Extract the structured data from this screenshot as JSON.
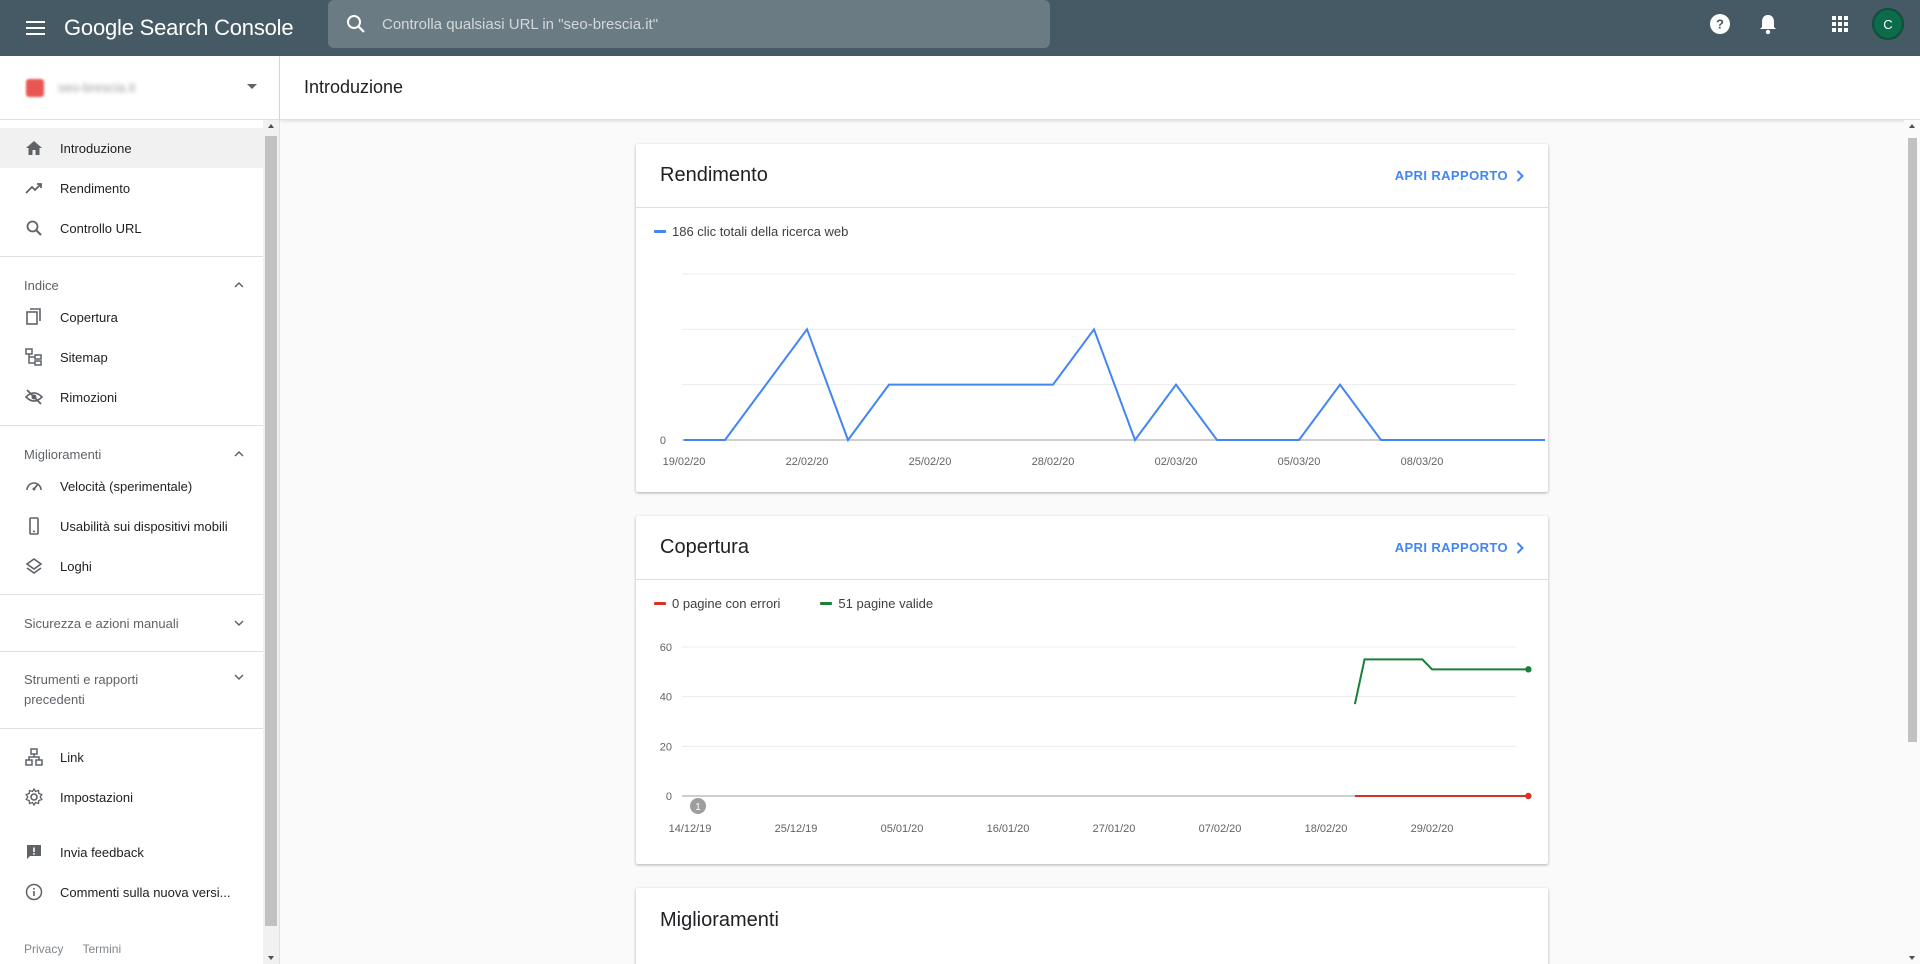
{
  "app": {
    "title": "Google Search Console"
  },
  "search": {
    "placeholder": "Controlla qualsiasi URL in \"seo-brescia.it\""
  },
  "user": {
    "avatar_initial": "C"
  },
  "property": {
    "name": "seo-brescia.it"
  },
  "sidebar": {
    "top_items": [
      {
        "label": "Introduzione",
        "icon": "home-icon",
        "active": true
      },
      {
        "label": "Rendimento",
        "icon": "trending-up-icon"
      },
      {
        "label": "Controllo URL",
        "icon": "search-icon"
      }
    ],
    "groups": [
      {
        "label": "Indice",
        "expanded": true,
        "items": [
          {
            "label": "Copertura",
            "icon": "copy-icon"
          },
          {
            "label": "Sitemap",
            "icon": "sitemap-icon"
          },
          {
            "label": "Rimozioni",
            "icon": "eye-off-icon"
          }
        ]
      },
      {
        "label": "Miglioramenti",
        "expanded": true,
        "items": [
          {
            "label": "Velocità (sperimentale)",
            "icon": "speedometer-icon"
          },
          {
            "label": "Usabilità sui dispositivi mobili",
            "icon": "smartphone-icon"
          },
          {
            "label": "Loghi",
            "icon": "layers-icon"
          }
        ]
      },
      {
        "label": "Sicurezza e azioni manuali",
        "expanded": false
      },
      {
        "label_line1": "Strumenti e rapporti",
        "label_line2": "precedenti",
        "expanded": false
      }
    ],
    "bottom_items": [
      {
        "label": "Link",
        "icon": "links-icon"
      },
      {
        "label": "Impostazioni",
        "icon": "gear-icon"
      }
    ],
    "feedback_items": [
      {
        "label": "Invia feedback",
        "icon": "feedback-icon"
      },
      {
        "label": "Commenti sulla nuova versi...",
        "icon": "info-icon"
      }
    ],
    "footer": {
      "privacy": "Privacy",
      "terms": "Termini"
    }
  },
  "page": {
    "title": "Introduzione"
  },
  "cards": {
    "rendimento": {
      "title": "Rendimento",
      "link": "APRI RAPPORTO",
      "legend": "186 clic totali della ricerca web",
      "color": "#4285f4"
    },
    "copertura": {
      "title": "Copertura",
      "link": "APRI RAPPORTO",
      "legend_errors": "0 pagine con errori",
      "legend_valid": "51 pagine valide",
      "color_errors": "#d93025",
      "color_valid": "#188038",
      "annotation": "1"
    },
    "miglioramenti": {
      "title": "Miglioramenti"
    }
  },
  "chart_data": [
    {
      "type": "line",
      "title": "",
      "x_tick_labels": [
        "19/02/20",
        "22/02/20",
        "25/02/20",
        "28/02/20",
        "02/03/20",
        "05/03/20",
        "08/03/20"
      ],
      "y_tick_labels": [
        "0"
      ],
      "ylim": [
        0,
        3
      ],
      "grid": true,
      "series": [
        {
          "values": [
            0,
            0,
            1,
            2,
            0,
            1,
            1,
            1,
            1,
            1,
            2,
            0,
            1,
            0,
            0,
            0,
            1,
            0,
            0,
            0,
            0,
            0
          ]
        }
      ]
    },
    {
      "type": "line",
      "title": "",
      "x_tick_labels": [
        "14/12/19",
        "25/12/19",
        "05/01/20",
        "16/01/20",
        "27/01/20",
        "07/02/20",
        "18/02/20",
        "29/02/20"
      ],
      "y_tick_labels": [
        "60",
        "40",
        "20",
        "0"
      ],
      "ylim": [
        0,
        60
      ],
      "grid": true,
      "series": [
        {
          "name": "0 pagine con errori",
          "x": [
            "21/02/20",
            "10/03/20"
          ],
          "values": [
            0,
            0
          ]
        },
        {
          "name": "51 pagine valide",
          "x": [
            "21/02/20",
            "22/02/20",
            "28/02/20",
            "29/02/20",
            "10/03/20"
          ],
          "values": [
            37,
            55,
            55,
            51,
            51
          ]
        }
      ]
    }
  ]
}
